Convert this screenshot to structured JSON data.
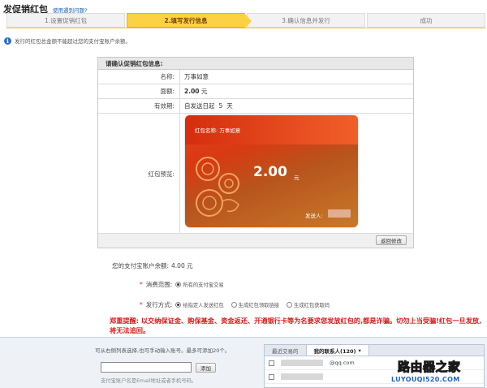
{
  "header": {
    "title": "发促销红包",
    "help_link": "使用遇到问题?"
  },
  "steps": [
    {
      "label": "1.设置促销红包",
      "active": false
    },
    {
      "label": "2.填写发行信息",
      "active": true
    },
    {
      "label": "3.确认信息并发行",
      "active": false
    },
    {
      "label": "成功",
      "active": false
    }
  ],
  "tip": {
    "icon": "info-icon",
    "text": "发行的红包总金额不能超过您的支付宝账户余额。"
  },
  "confirm": {
    "heading": "请确认促销红包信息:",
    "name_label": "名称:",
    "name_value": "万事如意",
    "amount_label": "面额:",
    "amount_value": "2.00",
    "amount_unit": "元",
    "validity_label": "有效期:",
    "validity_value": "自发送日起",
    "validity_days": "5",
    "validity_unit": "天",
    "preview_label": "红包预览:",
    "back_button": "返回修改"
  },
  "card": {
    "name_prefix": "红包名称:",
    "name": "万事如意",
    "amount": "2.00",
    "unit": "元",
    "sender_label": "发送人:"
  },
  "balance": {
    "label": "您的支付宝账户余额:",
    "value": "4.00 元"
  },
  "scope": {
    "label": "消费范围:",
    "options": [
      {
        "label": "所有的支付宝交易",
        "checked": true
      }
    ]
  },
  "issue": {
    "label": "发行方式:",
    "options": [
      {
        "label": "给指定人发送红包",
        "checked": true
      },
      {
        "label": "生成红包领取链接",
        "checked": false
      },
      {
        "label": "生成红包获取码",
        "checked": false
      }
    ]
  },
  "warning": "郑重提醒: 以交纳保证金、购保基金、资金返还、开通银行卡等为名要求您发放红包的,都是诈骗。切勿上当受骗!红包一旦发放,将无法追回。",
  "recipients": {
    "hint": "可从右侧列表选择,也可手动输入账号。最多可添加20个。",
    "input_placeholder": "",
    "add_button": "添加",
    "note": "支付宝账户名是Email地址或者手机号码。",
    "tabs": [
      {
        "label": "最近交易的",
        "active": false
      },
      {
        "label": "我的联系人(120)",
        "active": true
      }
    ],
    "tab_dropdown_icon": "chevron-down-icon",
    "rows": [
      {
        "suffix": "@qq.com"
      },
      {
        "suffix": ""
      }
    ]
  },
  "watermark": {
    "big": "路由器之家",
    "small": "LUYOUQI520.COM"
  },
  "colors": {
    "step_active": "#fcd243",
    "warning": "#e01818",
    "card_red": "#e8411c"
  }
}
